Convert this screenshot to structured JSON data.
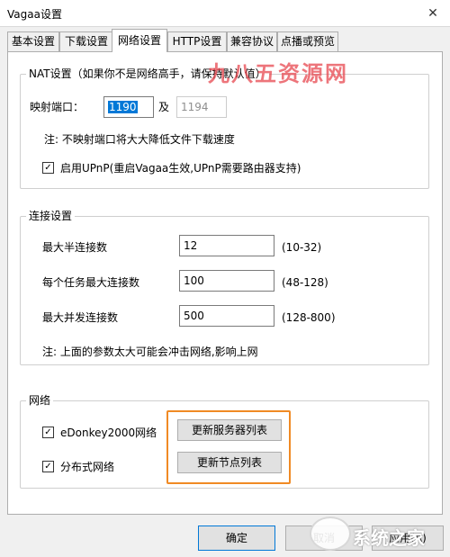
{
  "window": {
    "title": "Vagaa设置",
    "close_glyph": "✕"
  },
  "tabs": [
    {
      "label": "基本设置",
      "active": false
    },
    {
      "label": "下载设置",
      "active": false
    },
    {
      "label": "网络设置",
      "active": true
    },
    {
      "label": "HTTP设置",
      "active": false
    },
    {
      "label": "兼容协议",
      "active": false
    },
    {
      "label": "点播或预览",
      "active": false
    }
  ],
  "nat": {
    "legend": "NAT设置（如果你不是网络高手，请保持默认值）",
    "port_label": "映射端口：",
    "port_value": "1190",
    "and_label": "及",
    "port2_value": "1194",
    "note": "注: 不映射端口将大大降低文件下载速度",
    "upnp_checked": true,
    "upnp_label": "启用UPnP(重启Vagaa生效,UPnP需要路由器支持)"
  },
  "connection": {
    "legend": "连接设置",
    "rows": [
      {
        "label": "最大半连接数",
        "value": "12",
        "range": "(10-32)"
      },
      {
        "label": "每个任务最大连接数",
        "value": "100",
        "range": "(48-128)"
      },
      {
        "label": "最大并发连接数",
        "value": "500",
        "range": "(128-800)"
      }
    ],
    "note": "注: 上面的参数太大可能会冲击网络,影响上网"
  },
  "network": {
    "legend": "网络",
    "edonkey_checked": true,
    "edonkey_label": "eDonkey2000网络",
    "dht_checked": true,
    "dht_label": "分布式网络",
    "update_servers_label": "更新服务器列表",
    "update_nodes_label": "更新节点列表",
    "highlight_color": "#f08a24"
  },
  "footer": {
    "ok_label": "确定",
    "cancel_label": "取消",
    "apply_label": "应用(A)"
  },
  "watermarks": {
    "top_text": "九八五资源网",
    "bottom_text": "系统之家"
  },
  "colors": {
    "selection": "#0078d7",
    "watermark_red": "#e8474f"
  }
}
